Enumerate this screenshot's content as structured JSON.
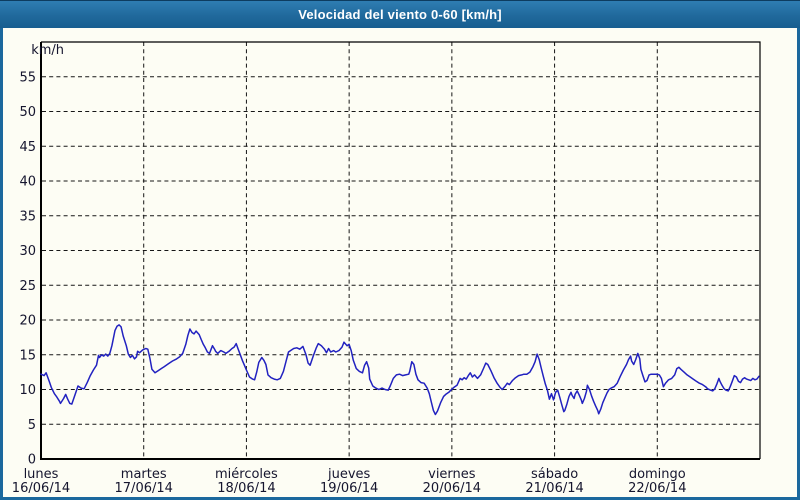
{
  "window": {
    "title": "Velocidad del viento 0-60 [km/h]"
  },
  "colors": {
    "titlebar_blue": "#20699c",
    "window_border": "#1b689d",
    "background": "#fdfdf4",
    "grid": "#161616",
    "axis": "#000000",
    "label_text": "#15152e",
    "series_line": "#2222c0"
  },
  "chart_data": {
    "type": "line",
    "title": "Velocidad del viento 0-60 [km/h]",
    "ylabel": "km/h",
    "ylim": [
      0,
      60
    ],
    "ytick_step": 5,
    "yticks": [
      0,
      5,
      10,
      15,
      20,
      25,
      30,
      35,
      40,
      45,
      50,
      55
    ],
    "grid": "dashed",
    "legend": "none",
    "xlim_days": [
      0,
      7
    ],
    "x_categories": [
      {
        "day": "lunes",
        "date": "16/06/14"
      },
      {
        "day": "martes",
        "date": "17/06/14"
      },
      {
        "day": "miércoles",
        "date": "18/06/14"
      },
      {
        "day": "jueves",
        "date": "19/06/14"
      },
      {
        "day": "viernes",
        "date": "20/06/14"
      },
      {
        "day": "sábado",
        "date": "21/06/14"
      },
      {
        "day": "domingo",
        "date": "22/06/14"
      }
    ],
    "series": [
      {
        "name": "Velocidad del viento",
        "unit": "km/h",
        "color": "#2222c0",
        "points": [
          [
            0,
            12.2
          ],
          [
            0.03,
            12
          ],
          [
            0.05,
            12.4
          ],
          [
            0.08,
            11.2
          ],
          [
            0.1,
            10.3
          ],
          [
            0.13,
            9.4
          ],
          [
            0.15,
            9
          ],
          [
            0.18,
            8.3
          ],
          [
            0.19,
            8
          ],
          [
            0.22,
            8.7
          ],
          [
            0.24,
            9.3
          ],
          [
            0.26,
            8.6
          ],
          [
            0.28,
            8
          ],
          [
            0.3,
            7.9
          ],
          [
            0.33,
            9.2
          ],
          [
            0.36,
            10.5
          ],
          [
            0.39,
            10.2
          ],
          [
            0.42,
            10.1
          ],
          [
            0.45,
            11
          ],
          [
            0.48,
            12
          ],
          [
            0.51,
            12.8
          ],
          [
            0.54,
            13.5
          ],
          [
            0.56,
            14.9
          ],
          [
            0.57,
            14.6
          ],
          [
            0.59,
            15
          ],
          [
            0.61,
            14.8
          ],
          [
            0.63,
            15.1
          ],
          [
            0.65,
            14.8
          ],
          [
            0.67,
            15.2
          ],
          [
            0.69,
            16.3
          ],
          [
            0.72,
            18.5
          ],
          [
            0.74,
            19.1
          ],
          [
            0.76,
            19.3
          ],
          [
            0.78,
            19
          ],
          [
            0.8,
            17.7
          ],
          [
            0.83,
            16.3
          ],
          [
            0.85,
            15.1
          ],
          [
            0.87,
            14.6
          ],
          [
            0.89,
            14.9
          ],
          [
            0.91,
            14.4
          ],
          [
            0.93,
            14.7
          ],
          [
            0.94,
            15.5
          ],
          [
            0.96,
            15.3
          ],
          [
            0.99,
            15.7
          ],
          [
            1.02,
            15.9
          ],
          [
            1.04,
            15.8
          ],
          [
            1.06,
            14.5
          ],
          [
            1.08,
            12.9
          ],
          [
            1.11,
            12.4
          ],
          [
            1.14,
            12.7
          ],
          [
            1.17,
            13
          ],
          [
            1.2,
            13.3
          ],
          [
            1.24,
            13.7
          ],
          [
            1.28,
            14.1
          ],
          [
            1.32,
            14.4
          ],
          [
            1.35,
            14.7
          ],
          [
            1.38,
            15.2
          ],
          [
            1.41,
            16.5
          ],
          [
            1.43,
            17.8
          ],
          [
            1.45,
            18.7
          ],
          [
            1.47,
            18.2
          ],
          [
            1.49,
            18
          ],
          [
            1.51,
            18.4
          ],
          [
            1.54,
            17.9
          ],
          [
            1.56,
            17.2
          ],
          [
            1.58,
            16.5
          ],
          [
            1.6,
            16
          ],
          [
            1.62,
            15.4
          ],
          [
            1.64,
            15.2
          ],
          [
            1.67,
            16.3
          ],
          [
            1.69,
            15.8
          ],
          [
            1.7,
            15.5
          ],
          [
            1.72,
            15.2
          ],
          [
            1.75,
            15.6
          ],
          [
            1.78,
            15.4
          ],
          [
            1.8,
            15.2
          ],
          [
            1.83,
            15.5
          ],
          [
            1.86,
            15.9
          ],
          [
            1.88,
            16.1
          ],
          [
            1.9,
            16.6
          ],
          [
            1.92,
            15.8
          ],
          [
            1.94,
            15
          ],
          [
            1.96,
            14.2
          ],
          [
            1.98,
            13.5
          ],
          [
            2,
            12.8
          ],
          [
            2.03,
            11.8
          ],
          [
            2.06,
            11.5
          ],
          [
            2.08,
            11.4
          ],
          [
            2.1,
            12.5
          ],
          [
            2.12,
            13.9
          ],
          [
            2.15,
            14.6
          ],
          [
            2.17,
            14.2
          ],
          [
            2.19,
            13.6
          ],
          [
            2.21,
            12.1
          ],
          [
            2.24,
            11.7
          ],
          [
            2.27,
            11.5
          ],
          [
            2.3,
            11.4
          ],
          [
            2.33,
            11.6
          ],
          [
            2.36,
            12.6
          ],
          [
            2.39,
            14.3
          ],
          [
            2.41,
            15.4
          ],
          [
            2.44,
            15.7
          ],
          [
            2.46,
            15.9
          ],
          [
            2.49,
            16
          ],
          [
            2.52,
            15.8
          ],
          [
            2.55,
            16.2
          ],
          [
            2.58,
            15
          ],
          [
            2.6,
            13.8
          ],
          [
            2.62,
            13.5
          ],
          [
            2.65,
            14.8
          ],
          [
            2.68,
            16
          ],
          [
            2.7,
            16.6
          ],
          [
            2.73,
            16.3
          ],
          [
            2.76,
            15.8
          ],
          [
            2.78,
            15.3
          ],
          [
            2.8,
            15.9
          ],
          [
            2.82,
            15.4
          ],
          [
            2.85,
            15.6
          ],
          [
            2.87,
            15.4
          ],
          [
            2.9,
            15.6
          ],
          [
            2.93,
            16.1
          ],
          [
            2.95,
            16.8
          ],
          [
            2.98,
            16.3
          ],
          [
            3,
            16.5
          ],
          [
            3.02,
            15.6
          ],
          [
            3.04,
            14.2
          ],
          [
            3.07,
            13
          ],
          [
            3.1,
            12.6
          ],
          [
            3.13,
            12.4
          ],
          [
            3.15,
            13.5
          ],
          [
            3.17,
            14
          ],
          [
            3.19,
            13.1
          ],
          [
            3.2,
            11.5
          ],
          [
            3.23,
            10.5
          ],
          [
            3.26,
            10.2
          ],
          [
            3.29,
            10
          ],
          [
            3.32,
            10.2
          ],
          [
            3.35,
            10
          ],
          [
            3.38,
            9.9
          ],
          [
            3.4,
            10.5
          ],
          [
            3.43,
            11.6
          ],
          [
            3.46,
            12.1
          ],
          [
            3.49,
            12.2
          ],
          [
            3.52,
            12
          ],
          [
            3.55,
            12.1
          ],
          [
            3.58,
            12.2
          ],
          [
            3.59,
            12.6
          ],
          [
            3.61,
            14
          ],
          [
            3.63,
            13.6
          ],
          [
            3.65,
            12.2
          ],
          [
            3.67,
            11.4
          ],
          [
            3.7,
            11
          ],
          [
            3.73,
            10.9
          ],
          [
            3.76,
            10.2
          ],
          [
            3.78,
            9.4
          ],
          [
            3.8,
            8.2
          ],
          [
            3.82,
            7
          ],
          [
            3.84,
            6.4
          ],
          [
            3.86,
            6.9
          ],
          [
            3.89,
            8.1
          ],
          [
            3.92,
            9
          ],
          [
            3.94,
            9.3
          ],
          [
            3.97,
            9.6
          ],
          [
            3.99,
            9.9
          ],
          [
            4.02,
            10.3
          ],
          [
            4.05,
            10.6
          ],
          [
            4.08,
            11.6
          ],
          [
            4.1,
            11.4
          ],
          [
            4.12,
            11.7
          ],
          [
            4.14,
            11.5
          ],
          [
            4.16,
            12
          ],
          [
            4.18,
            12.4
          ],
          [
            4.2,
            11.8
          ],
          [
            4.22,
            12.1
          ],
          [
            4.25,
            11.6
          ],
          [
            4.28,
            12.1
          ],
          [
            4.31,
            13.1
          ],
          [
            4.33,
            13.8
          ],
          [
            4.35,
            13.6
          ],
          [
            4.38,
            12.7
          ],
          [
            4.41,
            11.7
          ],
          [
            4.44,
            10.9
          ],
          [
            4.47,
            10.3
          ],
          [
            4.49,
            10
          ],
          [
            4.52,
            10.5
          ],
          [
            4.54,
            10.9
          ],
          [
            4.56,
            10.7
          ],
          [
            4.59,
            11.3
          ],
          [
            4.62,
            11.7
          ],
          [
            4.65,
            12
          ],
          [
            4.68,
            12.1
          ],
          [
            4.7,
            12.2
          ],
          [
            4.73,
            12.2
          ],
          [
            4.76,
            12.5
          ],
          [
            4.79,
            13.3
          ],
          [
            4.81,
            14
          ],
          [
            4.83,
            15.1
          ],
          [
            4.85,
            14.3
          ],
          [
            4.87,
            13.1
          ],
          [
            4.89,
            11.9
          ],
          [
            4.91,
            10.8
          ],
          [
            4.93,
            9.9
          ],
          [
            4.95,
            8.6
          ],
          [
            4.97,
            9.4
          ],
          [
            4.99,
            8.5
          ],
          [
            5.01,
            9.6
          ],
          [
            5.03,
            9.9
          ],
          [
            5.05,
            8.9
          ],
          [
            5.07,
            7.8
          ],
          [
            5.09,
            6.8
          ],
          [
            5.1,
            7
          ],
          [
            5.12,
            7.9
          ],
          [
            5.14,
            9
          ],
          [
            5.16,
            9.6
          ],
          [
            5.17,
            9.2
          ],
          [
            5.19,
            8.7
          ],
          [
            5.2,
            9.3
          ],
          [
            5.22,
            9.8
          ],
          [
            5.24,
            9.2
          ],
          [
            5.26,
            8.5
          ],
          [
            5.27,
            8
          ],
          [
            5.29,
            8.7
          ],
          [
            5.31,
            9.7
          ],
          [
            5.32,
            10.6
          ],
          [
            5.34,
            10
          ],
          [
            5.36,
            9.1
          ],
          [
            5.38,
            8.3
          ],
          [
            5.4,
            7.6
          ],
          [
            5.42,
            7
          ],
          [
            5.43,
            6.5
          ],
          [
            5.45,
            7.2
          ],
          [
            5.47,
            8.1
          ],
          [
            5.49,
            8.8
          ],
          [
            5.51,
            9.5
          ],
          [
            5.53,
            10
          ],
          [
            5.55,
            10.2
          ],
          [
            5.58,
            10.4
          ],
          [
            5.61,
            10.9
          ],
          [
            5.64,
            11.9
          ],
          [
            5.67,
            12.8
          ],
          [
            5.7,
            13.6
          ],
          [
            5.72,
            14.3
          ],
          [
            5.74,
            14.8
          ],
          [
            5.75,
            14.1
          ],
          [
            5.77,
            13.6
          ],
          [
            5.79,
            14.3
          ],
          [
            5.81,
            15.2
          ],
          [
            5.83,
            14.4
          ],
          [
            5.84,
            12.9
          ],
          [
            5.86,
            12
          ],
          [
            5.88,
            11.1
          ],
          [
            5.9,
            11.3
          ],
          [
            5.92,
            12.1
          ],
          [
            5.94,
            12.2
          ],
          [
            5.97,
            12.2
          ],
          [
            6,
            12.2
          ],
          [
            6.02,
            12.1
          ],
          [
            6.04,
            11.6
          ],
          [
            6.06,
            10.4
          ],
          [
            6.08,
            10.9
          ],
          [
            6.11,
            11.4
          ],
          [
            6.14,
            11.6
          ],
          [
            6.17,
            12.1
          ],
          [
            6.19,
            13
          ],
          [
            6.21,
            13.2
          ],
          [
            6.23,
            12.9
          ],
          [
            6.26,
            12.5
          ],
          [
            6.29,
            12.1
          ],
          [
            6.32,
            11.8
          ],
          [
            6.35,
            11.5
          ],
          [
            6.38,
            11.2
          ],
          [
            6.41,
            10.9
          ],
          [
            6.44,
            10.7
          ],
          [
            6.47,
            10.4
          ],
          [
            6.49,
            10.1
          ],
          [
            6.52,
            9.9
          ],
          [
            6.54,
            9.8
          ],
          [
            6.56,
            10.1
          ],
          [
            6.58,
            10.8
          ],
          [
            6.6,
            11.6
          ],
          [
            6.61,
            11.2
          ],
          [
            6.63,
            10.6
          ],
          [
            6.65,
            10.1
          ],
          [
            6.67,
            9.9
          ],
          [
            6.69,
            9.8
          ],
          [
            6.71,
            10.4
          ],
          [
            6.73,
            11.2
          ],
          [
            6.75,
            12
          ],
          [
            6.77,
            11.8
          ],
          [
            6.79,
            11.2
          ],
          [
            6.81,
            11
          ],
          [
            6.83,
            11.5
          ],
          [
            6.85,
            11.7
          ],
          [
            6.87,
            11.5
          ],
          [
            6.89,
            11.4
          ],
          [
            6.91,
            11.3
          ],
          [
            6.93,
            11.6
          ],
          [
            6.95,
            11.4
          ],
          [
            6.97,
            11.5
          ],
          [
            6.99,
            11.9
          ]
        ]
      }
    ]
  }
}
